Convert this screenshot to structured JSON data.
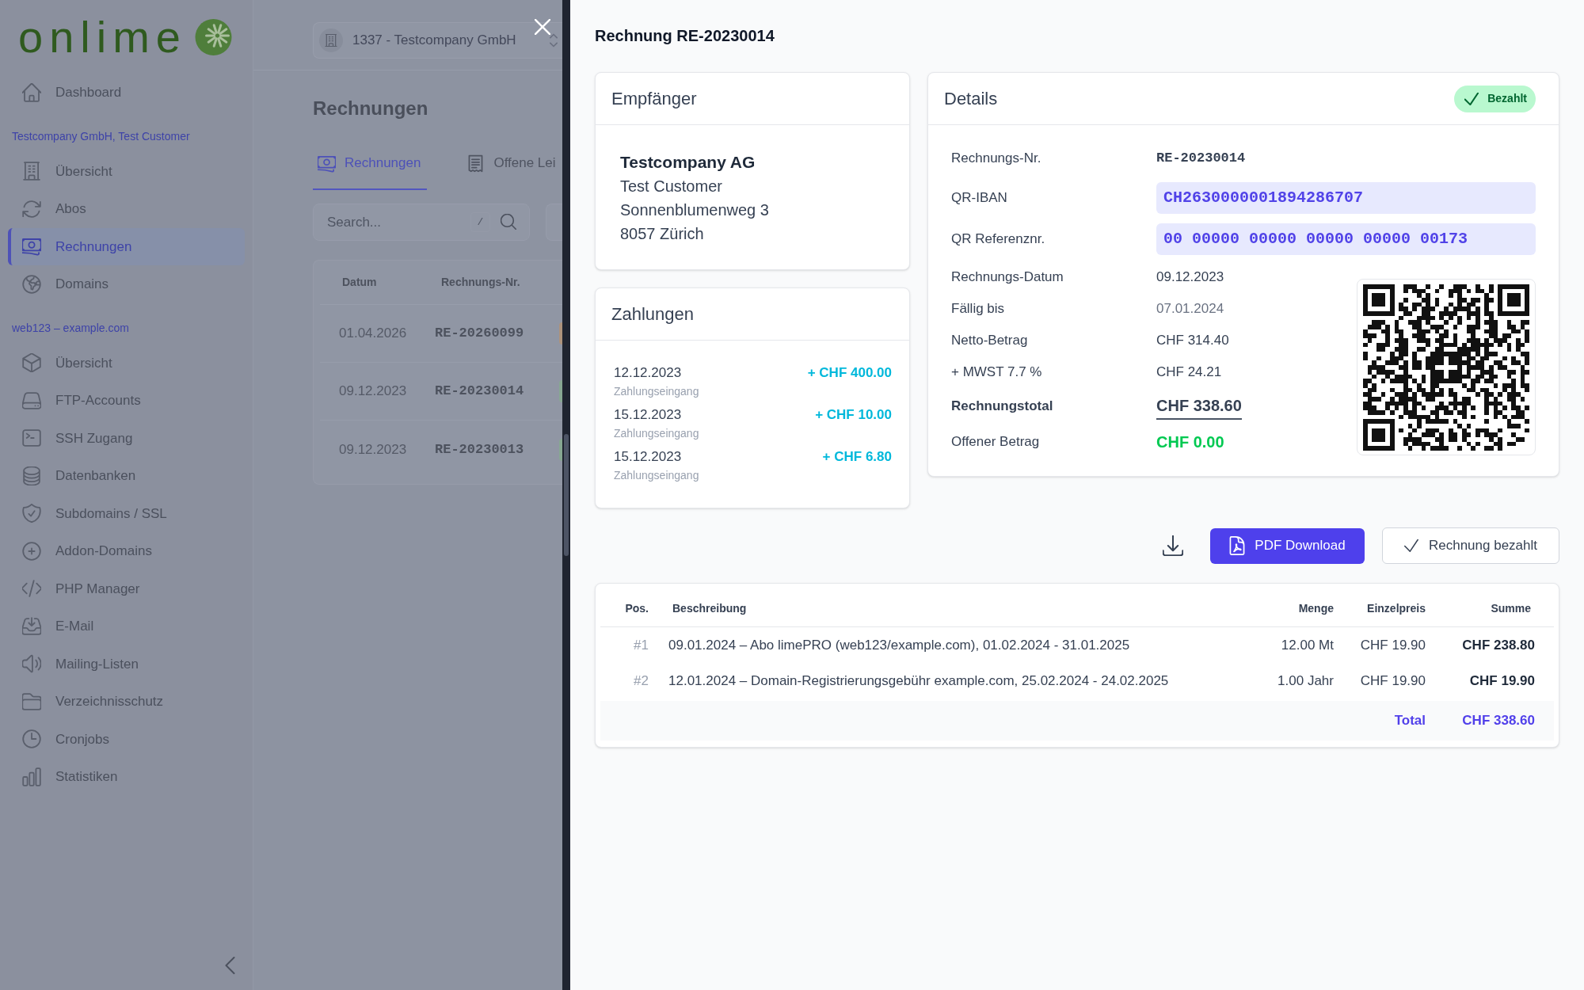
{
  "sidebar": {
    "logo": "onlime",
    "top_items": [
      {
        "label": "Dashboard",
        "selected": false
      }
    ],
    "sections": [
      {
        "heading": "Testcompany GmbH, Test Customer",
        "items": [
          {
            "label": "Übersicht",
            "selected": false
          },
          {
            "label": "Abos",
            "selected": false
          },
          {
            "label": "Rechnungen",
            "selected": true
          },
          {
            "label": "Domains",
            "selected": false
          }
        ]
      },
      {
        "heading": "web123 – example.com",
        "items": [
          {
            "label": "Übersicht",
            "selected": false
          },
          {
            "label": "FTP-Accounts",
            "selected": false
          },
          {
            "label": "SSH Zugang",
            "selected": false
          },
          {
            "label": "Datenbanken",
            "selected": false
          },
          {
            "label": "Subdomains / SSL",
            "selected": false
          },
          {
            "label": "Addon-Domains",
            "selected": false
          },
          {
            "label": "PHP Manager",
            "selected": false
          },
          {
            "label": "E-Mail",
            "selected": false
          },
          {
            "label": "Mailing-Listen",
            "selected": false
          },
          {
            "label": "Verzeichnisschutz",
            "selected": false
          },
          {
            "label": "Cronjobs",
            "selected": false
          },
          {
            "label": "Statistiken",
            "selected": false
          }
        ]
      }
    ]
  },
  "main": {
    "account_select": {
      "value": "1337 - Testcompany GmbH"
    },
    "heading": "Rechnungen",
    "tabs": [
      {
        "label": "Rechnungen",
        "selected": true
      },
      {
        "label": "Offene Lei",
        "selected": false
      }
    ],
    "search": {
      "placeholder": "Search...",
      "shortcut": "/"
    },
    "table": {
      "columns": [
        "Datum",
        "Rechnungs-Nr."
      ],
      "rows": [
        {
          "date": "01.04.2026",
          "number": "RE-20260099",
          "color": "#ad937d"
        },
        {
          "date": "09.12.2023",
          "number": "RE-20230014",
          "color": "#87a792"
        },
        {
          "date": "09.12.2023",
          "number": "RE-20230013",
          "color": "#87a792"
        }
      ]
    }
  },
  "drawer": {
    "title": "Rechnung RE-20230014",
    "recipient": {
      "title": "Empfänger",
      "company": "Testcompany AG",
      "lines": [
        "Test Customer",
        "Sonnenblumenweg 3",
        "8057 Zürich"
      ]
    },
    "payments": {
      "title": "Zahlungen",
      "items": [
        {
          "date": "12.12.2023",
          "type": "Zahlungseingang",
          "amount": "+ CHF 400.00"
        },
        {
          "date": "15.12.2023",
          "type": "Zahlungseingang",
          "amount": "+ CHF 10.00"
        },
        {
          "date": "15.12.2023",
          "type": "Zahlungseingang",
          "amount": "+ CHF 6.80"
        }
      ]
    },
    "details": {
      "title": "Details",
      "status": {
        "kind": "paid",
        "label": "Bezahlt"
      },
      "reference_fields": [
        {
          "kind": "mono",
          "label": "Rechnungs-Nr.",
          "value": "RE-20230014"
        },
        {
          "kind": "code",
          "label": "QR-IBAN",
          "value": "CH2630000001894286707"
        },
        {
          "kind": "code",
          "label": "QR Referenznr.",
          "value": "00 00000 00000 00000 00000 00173"
        }
      ],
      "amount_fields": [
        {
          "kind": "plain",
          "label": "Rechnungs-Datum",
          "value": "09.12.2023"
        },
        {
          "kind": "muted",
          "label": "Fällig bis",
          "value": "07.01.2024"
        },
        {
          "kind": "plain",
          "label": "Netto-Betrag",
          "value": "CHF 314.40"
        },
        {
          "kind": "plain",
          "label": "+ MWST 7.7 %",
          "value": "CHF 24.21"
        },
        {
          "kind": "total",
          "label": "Rechnungstotal",
          "value": "CHF 338.60"
        },
        {
          "kind": "open",
          "label": "Offener Betrag",
          "value": "CHF 0.00"
        }
      ]
    },
    "buttons": [
      {
        "kind": "primary",
        "label": "PDF Download"
      },
      {
        "kind": "outline",
        "label": "Rechnung bezahlt"
      }
    ],
    "items_table": {
      "columns": [
        "Pos.",
        "Beschreibung",
        "Menge",
        "Einzelpreis",
        "Summe"
      ],
      "rows": [
        {
          "pos": "#1",
          "description": "09.01.2024 – Abo limePRO (web123/example.com), 01.02.2024 - 31.01.2025",
          "quantity": "12.00 Mt",
          "unit_price": "CHF 19.90",
          "total": "CHF 238.80"
        },
        {
          "pos": "#2",
          "description": "12.01.2024 – Domain-Registrierungsgebühr example.com, 25.02.2024 - 24.02.2025",
          "quantity": "1.00 Jahr",
          "unit_price": "CHF 19.90",
          "total": "CHF 19.90"
        }
      ],
      "total": {
        "label": "Total",
        "value": "CHF 338.60"
      }
    }
  }
}
